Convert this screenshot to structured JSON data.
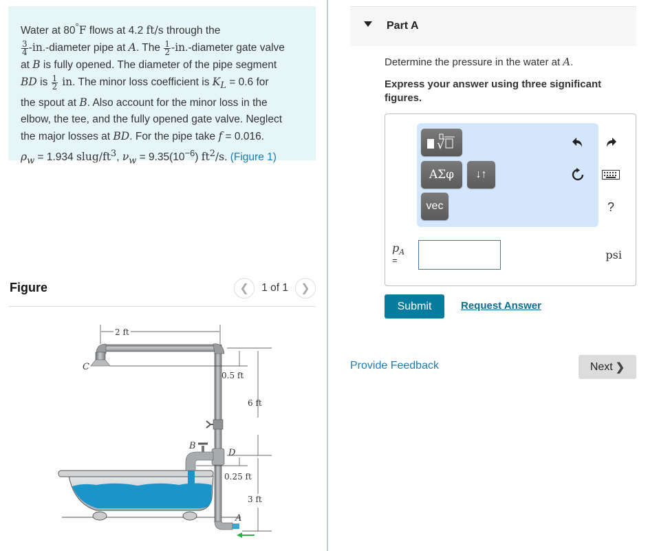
{
  "problem": {
    "line1_pre": "Water at 80",
    "line1_deg": "°",
    "line1_F": "F",
    "line1_mid": " flows at 4.2 ",
    "line1_unit": "ft/s",
    "line1_post": " through the",
    "frac_a_num": "3",
    "frac_a_den": "4",
    "line2_in": "-in",
    "line2_mid": ".-diameter pipe at ",
    "line2_A": "A",
    "line2_post": ". The ",
    "frac_b_num": "1",
    "frac_b_den": "2",
    "line2_in2": "-in",
    "line2_end": ".-diameter gate valve",
    "line3_pre": "at ",
    "line3_B": "B",
    "line3_post": " is fully opened. The diameter of the pipe segment",
    "line4_BD": "BD",
    "line4_is": " is ",
    "frac_c_num": "1",
    "frac_c_den": "2",
    "line4_in": " in",
    "line4_mid": ". The minor loss coefficient is ",
    "line4_K": "K",
    "line4_Ksub": "L",
    "line4_post": " = 0.6 for",
    "line5_pre": "the spout at ",
    "line5_B": "B",
    "line5_post": ". Also account for the minor loss in the",
    "line6": "elbow, the tee, and the fully opened gate valve. Neglect",
    "line7_pre": "the major losses at ",
    "line7_BD": "BD",
    "line7_mid": ". For the pipe take ",
    "line7_f": "f",
    "line7_post": " = 0.016.",
    "line8_rho": "ρ",
    "line8_rhosub": "w",
    "line8_a": " = 1.934 ",
    "line8_unit1": "slug/ft",
    "line8_unit1sup": "3",
    "line8_b": ", ",
    "line8_nu": "ν",
    "line8_nusub": "w",
    "line8_c": " = 9.35(10",
    "line8_exp": "−6",
    "line8_d": ") ",
    "line8_unit2": "ft",
    "line8_unit2sup": "2",
    "line8_unit2post": "/s",
    "line8_e": ". ",
    "figure_link": "(Figure 1)"
  },
  "figure": {
    "title": "Figure",
    "pager_text": "1 of 1",
    "prev_icon": "chevron-left-icon",
    "next_icon": "chevron-right-icon",
    "labels": {
      "width": "2 ft",
      "drop_c": "0.5 ft",
      "height_upper": "6 ft",
      "drop_b": "0.25 ft",
      "height_lower": "3 ft",
      "point_a": "A",
      "point_b": "B",
      "point_c": "C",
      "point_d": "D"
    },
    "colors": {
      "water": "#1b95c9",
      "pipe": "#a9acaf",
      "arrow": "#2bb24c"
    }
  },
  "part": {
    "title": "Part A",
    "question": "Determine the pressure in the water at ",
    "question_var": "A",
    "question_end": ".",
    "instruction": "Express your answer using three significant figures."
  },
  "toolbar": {
    "templates_icon": "fraction-root-icon",
    "greek_label": "ΑΣφ",
    "arrows_label": "↓↑",
    "vec_label": "vec",
    "undo_icon": "undo-icon",
    "redo_icon": "redo-icon",
    "reset_icon": "reset-icon",
    "keyboard_icon": "keyboard-icon",
    "help_label": "?"
  },
  "answer": {
    "variable": "p",
    "variable_sub": "A",
    "equals": "=",
    "value": "",
    "unit": "psi"
  },
  "actions": {
    "submit": "Submit",
    "request_answer": "Request Answer",
    "feedback": "Provide Feedback",
    "next": "Next",
    "next_chevron": "❯"
  },
  "colors": {
    "problem_bg": "#e6f5f8",
    "submit_bg": "#077c9e",
    "link": "#1a7bb5",
    "toolbar_bg": "#d3e6fb",
    "input_border": "#3b74c9"
  }
}
